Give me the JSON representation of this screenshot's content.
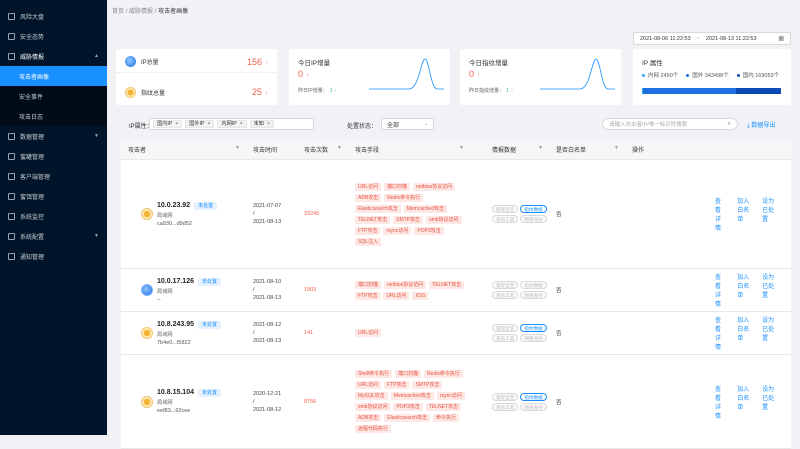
{
  "sidebar": {
    "items": [
      {
        "label": "风险大盘",
        "icon": "dashboard-icon"
      },
      {
        "label": "安全态势",
        "icon": "monitor-icon"
      },
      {
        "label": "威胁情报",
        "icon": "intel-icon",
        "expanded": true
      },
      {
        "label": "数据管理",
        "icon": "data-icon"
      },
      {
        "label": "蜜罐管理",
        "icon": "honeypot-icon"
      },
      {
        "label": "客户端管理",
        "icon": "client-icon"
      },
      {
        "label": "蜜饵管理",
        "icon": "bait-icon"
      },
      {
        "label": "系统监控",
        "icon": "system-monitor-icon"
      },
      {
        "label": "系统配置",
        "icon": "gear-icon"
      },
      {
        "label": "通知管理",
        "icon": "bell-icon"
      }
    ],
    "submenu": [
      {
        "label": "攻击者画像",
        "active": true
      },
      {
        "label": "安全事件"
      },
      {
        "label": "攻击日志"
      }
    ]
  },
  "breadcrumb": {
    "home": "首页",
    "sep": "/",
    "parent": "威胁情报",
    "current": "攻击者画像"
  },
  "date_range": {
    "start": "2021-08-06 11:22:53",
    "sep": "~",
    "end": "2021-08-13 11:22:53"
  },
  "stats": {
    "ip_total": {
      "label": "IP总量",
      "value": "156",
      "arrow": "↑"
    },
    "indicator_total": {
      "label": "指纹总量",
      "value": "25",
      "arrow": "↑"
    }
  },
  "daily_ip": {
    "title": "今日IP增量",
    "value": "0",
    "arrow": "↑",
    "sub": "昨日IP增量：",
    "sub_value": "1",
    "sub_arrow": "↑"
  },
  "daily_fp": {
    "title": "今日指纹增量",
    "value": "0",
    "arrow": "↑",
    "sub": "昨日指纹增量：",
    "sub_value": "1",
    "sub_arrow": "↑"
  },
  "ip_attr": {
    "title": "IP 属性",
    "legend": [
      {
        "label": "内网",
        "count": "2450个",
        "color": "#36a3f7"
      },
      {
        "label": "国外",
        "count": "343498个",
        "color": "#1e6fe0"
      },
      {
        "label": "国内",
        "count": "169053个",
        "color": "#0e4ab3"
      }
    ],
    "bar": [
      0.004,
      0.67,
      0.326
    ]
  },
  "filters": {
    "ip_attr_label": "IP属性：",
    "tags": [
      "国内IP",
      "国外IP",
      "内网IP",
      "未知"
    ],
    "status_label": "处置状态：",
    "status_value": "全部",
    "search_placeholder": "请输入攻击者IP/唯一标识符搜索",
    "export": "数据导出"
  },
  "table": {
    "headers": [
      "攻击者",
      "攻击时间",
      "攻击次数",
      "攻击手段",
      "情报数据",
      "是否白名单",
      "操作"
    ],
    "actions": [
      "查看详情",
      "加入白名单",
      "设为已处置"
    ],
    "rows": [
      {
        "ip": "10.0.23.92",
        "status": "未处置",
        "net": "局域网",
        "hash": "ca930...d9d52",
        "icon": "yellow",
        "t1": "2021-07-07",
        "tsep": "/",
        "t2": "2021-08-13",
        "count": "33245",
        "means": [
          "URL访问",
          "端口扫描",
          "netbios协议访问",
          "ADB攻击",
          "Redis命令执行",
          "Elasticsearch攻击",
          "Memcached攻击",
          "TELNET攻击",
          "SMTP攻击",
          "smb协议访问",
          "FTP攻击",
          "rsync访问",
          "POP3攻击",
          "SQL注入"
        ],
        "intel": [
          {
            "t": "盛际全空",
            "on": false
          },
          {
            "t": "指纹数据",
            "on": true
          },
          {
            "t": "攻击工具",
            "on": false
          },
          {
            "t": "网络身份",
            "on": false
          }
        ],
        "wl": "否"
      },
      {
        "ip": "10.0.17.126",
        "status": "未处置",
        "net": "局域网",
        "hash": "--",
        "icon": "blue",
        "t1": "2021-08-10",
        "tsep": "/",
        "t2": "2021-08-13",
        "count": "1903",
        "means": [
          "端口扫描",
          "netbios协议访问",
          "TELNET攻击",
          "FTP攻击",
          "URL访问",
          "XSS"
        ],
        "intel": [
          {
            "t": "盛际全空",
            "on": false
          },
          {
            "t": "指纹数据",
            "on": false
          },
          {
            "t": "攻击工具",
            "on": false
          },
          {
            "t": "网络身份",
            "on": false
          }
        ],
        "wl": "否"
      },
      {
        "ip": "10.8.243.95",
        "status": "未处置",
        "net": "局域网",
        "hash": "7b4e0...f5822",
        "icon": "yellow",
        "t1": "2021-08-12",
        "tsep": "/",
        "t2": "2021-08-13",
        "count": "141",
        "means": [
          "URL访问"
        ],
        "intel": [
          {
            "t": "盛际全空",
            "on": false
          },
          {
            "t": "指纹数据",
            "on": true
          },
          {
            "t": "攻击工具",
            "on": false
          },
          {
            "t": "网络身份",
            "on": false
          }
        ],
        "wl": "否"
      },
      {
        "ip": "10.8.15.104",
        "status": "未处置",
        "net": "局域网",
        "hash": "eef83...62cee",
        "icon": "yellow",
        "t1": "2020-12-21",
        "tsep": "/",
        "t2": "2021-08-12",
        "count": "8756",
        "means": [
          "Shell命令执行",
          "端口扫描",
          "Redis命令执行",
          "URL访问",
          "FTP攻击",
          "SMTP攻击",
          "MySQL攻击",
          "Memcached攻击",
          "rsync访问",
          "smb协议访问",
          "POP3攻击",
          "TELNET攻击",
          "ADB攻击",
          "Elasticsearch攻击",
          "命令执行",
          "远程代码执行"
        ],
        "intel": [
          {
            "t": "盛际全空",
            "on": false
          },
          {
            "t": "指纹数据",
            "on": true
          },
          {
            "t": "攻击工具",
            "on": false
          },
          {
            "t": "网络身份",
            "on": false
          }
        ],
        "wl": "否"
      }
    ]
  }
}
